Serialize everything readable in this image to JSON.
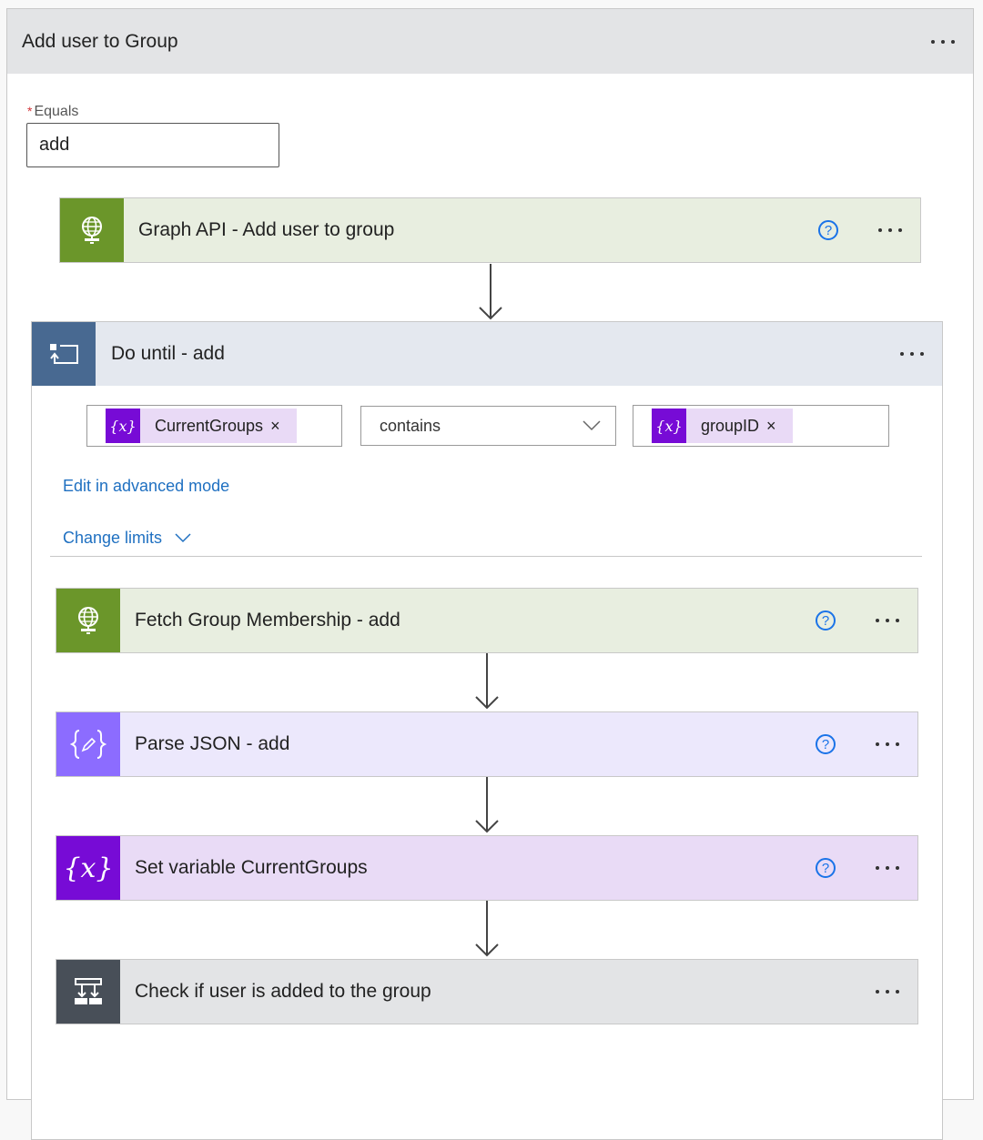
{
  "scope": {
    "title": "Add user to Group",
    "equals_label": "Equals",
    "equals_required_marker": "*",
    "equals_value": "add"
  },
  "graph_action": {
    "title": "Graph API - Add user to group",
    "icon": "globe-network-icon",
    "help_glyph": "?"
  },
  "do_until": {
    "title": "Do until - add",
    "icon": "loop-icon",
    "condition": {
      "left_token": {
        "label": "CurrentGroups",
        "icon": "variable-icon",
        "icon_glyph": "{x}",
        "remove_glyph": "×"
      },
      "operator": "contains",
      "right_token": {
        "label": "groupID",
        "icon": "variable-icon",
        "icon_glyph": "{x}",
        "remove_glyph": "×"
      }
    },
    "edit_advanced_label": "Edit in advanced mode",
    "change_limits_label": "Change limits",
    "actions": [
      {
        "title": "Fetch Group Membership - add",
        "icon": "globe-network-icon",
        "help_glyph": "?"
      },
      {
        "title": "Parse JSON - add",
        "icon": "parse-json-icon",
        "help_glyph": "?"
      },
      {
        "title": "Set variable CurrentGroups",
        "icon": "variable-icon",
        "icon_glyph": "{x}",
        "help_glyph": "?"
      },
      {
        "title": "Check if user is added to the group",
        "icon": "condition-icon"
      }
    ]
  },
  "colors": {
    "http_accent": "#6b962a",
    "loop_accent": "#486991",
    "variable_accent": "#770bd6",
    "parse_accent": "#8c6cff",
    "condition_accent": "#484f58",
    "link": "#1f70c1",
    "help": "#1a73e8"
  }
}
